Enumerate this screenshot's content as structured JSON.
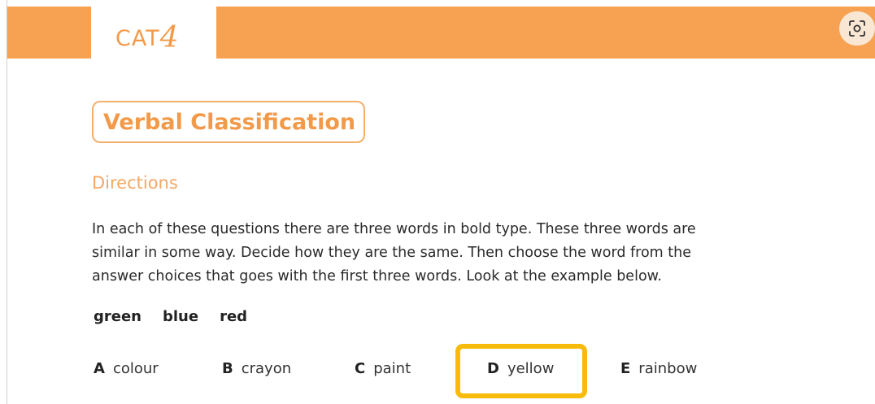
{
  "header": {
    "logo_text": "CAT",
    "logo_digit": "4",
    "brand_color": "#f7a252",
    "screenshot_icon": "scan-icon"
  },
  "section": {
    "title": "Verbal Classification",
    "directions_label": "Directions",
    "instructions": [
      "In each of these questions there are three words in bold type. These three words are",
      "similar in some way. Decide how they are the same. Then choose the word from the",
      "answer choices that goes with the first three words. Look at the example below."
    ]
  },
  "example": {
    "words": [
      "green",
      "blue",
      "red"
    ],
    "choices": [
      {
        "letter": "A",
        "text": "colour"
      },
      {
        "letter": "B",
        "text": "crayon"
      },
      {
        "letter": "C",
        "text": "paint"
      },
      {
        "letter": "D",
        "text": "yellow"
      },
      {
        "letter": "E",
        "text": "rainbow"
      }
    ],
    "selected_letter": "D",
    "highlight_color": "#f7bb0c"
  }
}
